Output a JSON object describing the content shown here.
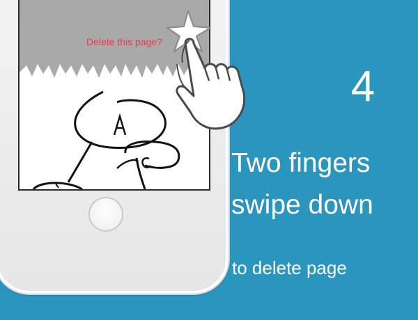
{
  "tutorial": {
    "step_number": "4",
    "instruction_line1": "Two fingers",
    "instruction_line2": "swipe down",
    "instruction_sub": "to delete page"
  },
  "screen": {
    "delete_prompt": "Delete this page?"
  },
  "colors": {
    "background": "#2a95bd",
    "prompt_text": "#e33b4f",
    "overlay": "#a9a9a9"
  },
  "icons": [
    "hand-pointer-icon",
    "sparkle-star-icon"
  ]
}
